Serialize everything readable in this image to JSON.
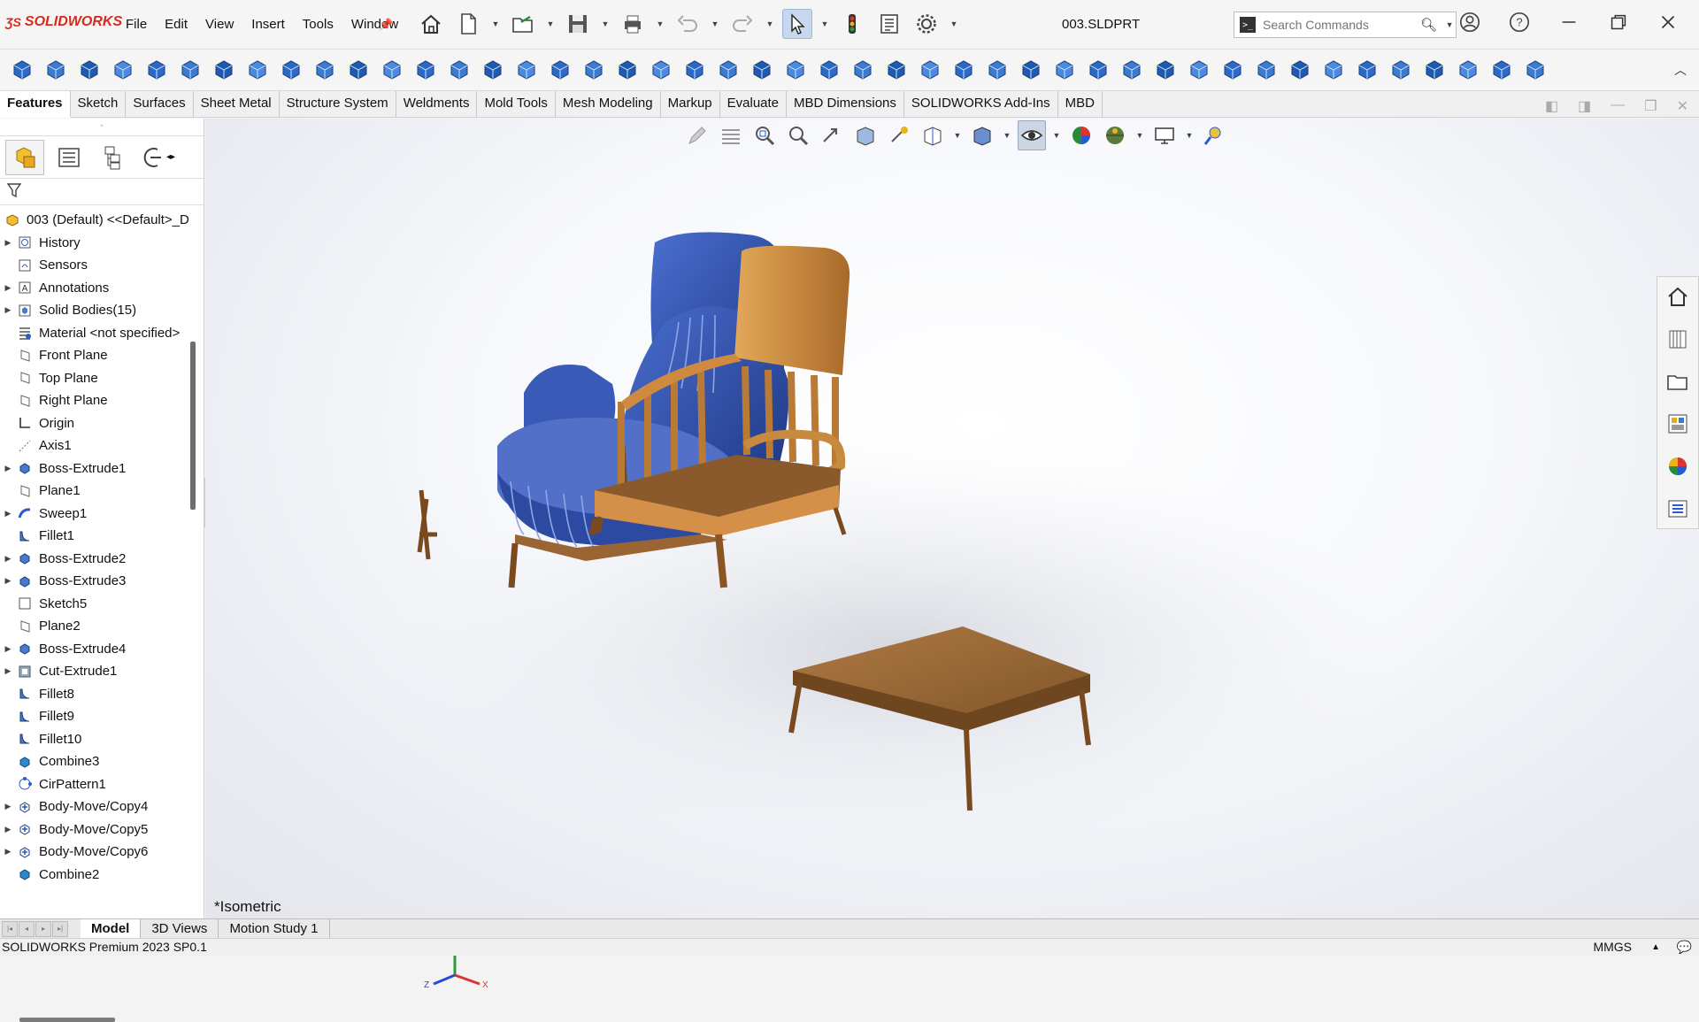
{
  "app": {
    "brand": "SOLIDWORKS",
    "doc_title": "003.SLDPRT"
  },
  "menu": [
    "File",
    "Edit",
    "View",
    "Insert",
    "Tools",
    "Window"
  ],
  "search": {
    "placeholder": "Search Commands"
  },
  "cmd_tabs": [
    "Features",
    "Sketch",
    "Surfaces",
    "Sheet Metal",
    "Structure System",
    "Weldments",
    "Mold Tools",
    "Mesh Modeling",
    "Markup",
    "Evaluate",
    "MBD Dimensions",
    "SOLIDWORKS Add-Ins",
    "MBD"
  ],
  "cmd_tab_selected": "Features",
  "tree": {
    "root": "003 (Default) <<Default>_D",
    "nodes": [
      {
        "label": "History",
        "icon": "history-icon",
        "expandable": true
      },
      {
        "label": "Sensors",
        "icon": "sensor-icon",
        "expandable": false
      },
      {
        "label": "Annotations",
        "icon": "annotation-icon",
        "expandable": true
      },
      {
        "label": "Solid Bodies(15)",
        "icon": "solid-bodies-icon",
        "expandable": true
      },
      {
        "label": "Material <not specified>",
        "icon": "material-icon",
        "expandable": false
      },
      {
        "label": "Front Plane",
        "icon": "plane-icon",
        "expandable": false
      },
      {
        "label": "Top Plane",
        "icon": "plane-icon",
        "expandable": false
      },
      {
        "label": "Right Plane",
        "icon": "plane-icon",
        "expandable": false
      },
      {
        "label": "Origin",
        "icon": "origin-icon",
        "expandable": false
      },
      {
        "label": "Axis1",
        "icon": "axis-icon",
        "expandable": false
      },
      {
        "label": "Boss-Extrude1",
        "icon": "extrude-icon",
        "expandable": true
      },
      {
        "label": "Plane1",
        "icon": "plane-icon",
        "expandable": false
      },
      {
        "label": "Sweep1",
        "icon": "sweep-icon",
        "expandable": true
      },
      {
        "label": "Fillet1",
        "icon": "fillet-icon",
        "expandable": false
      },
      {
        "label": "Boss-Extrude2",
        "icon": "extrude-icon",
        "expandable": true
      },
      {
        "label": "Boss-Extrude3",
        "icon": "extrude-icon",
        "expandable": true
      },
      {
        "label": "Sketch5",
        "icon": "sketch-icon",
        "expandable": false
      },
      {
        "label": "Plane2",
        "icon": "plane-icon",
        "expandable": false
      },
      {
        "label": "Boss-Extrude4",
        "icon": "extrude-icon",
        "expandable": true
      },
      {
        "label": "Cut-Extrude1",
        "icon": "cut-extrude-icon",
        "expandable": true
      },
      {
        "label": "Fillet8",
        "icon": "fillet-icon",
        "expandable": false
      },
      {
        "label": "Fillet9",
        "icon": "fillet-icon",
        "expandable": false
      },
      {
        "label": "Fillet10",
        "icon": "fillet-icon",
        "expandable": false
      },
      {
        "label": "Combine3",
        "icon": "combine-icon",
        "expandable": false
      },
      {
        "label": "CirPattern1",
        "icon": "pattern-icon",
        "expandable": false
      },
      {
        "label": "Body-Move/Copy4",
        "icon": "move-copy-icon",
        "expandable": true
      },
      {
        "label": "Body-Move/Copy5",
        "icon": "move-copy-icon",
        "expandable": true
      },
      {
        "label": "Body-Move/Copy6",
        "icon": "move-copy-icon",
        "expandable": true
      },
      {
        "label": "Combine2",
        "icon": "combine-icon",
        "expandable": false
      }
    ]
  },
  "viewport": {
    "view_name": "*Isometric",
    "axes": {
      "x": "X",
      "y": "Y",
      "z": "Z"
    }
  },
  "bottom_tabs": [
    "Model",
    "3D Views",
    "Motion Study 1"
  ],
  "bottom_tab_selected": "Model",
  "status": {
    "product": "SOLIDWORKS Premium 2023 SP0.1",
    "units": "MMGS"
  },
  "colors": {
    "accent": "#d52b1e",
    "armchair": "#2b4ba8",
    "wood": "#c78a3e",
    "table": "#9a6a38"
  }
}
